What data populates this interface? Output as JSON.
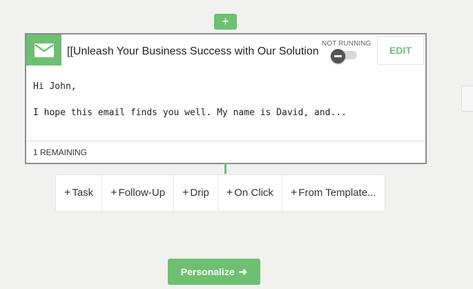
{
  "top_add": {
    "label": "+"
  },
  "card": {
    "title": "[[Unleash Your Business Success with Our Solution",
    "status": "NOT RUNNING",
    "running": false,
    "edit_label": "EDIT",
    "body_lines": [
      "Hi John,",
      "I hope this email finds you well. My name is David, and..."
    ],
    "remaining": "1 REMAINING"
  },
  "actions": [
    {
      "label": "Task"
    },
    {
      "label": "Follow-Up"
    },
    {
      "label": "Drip"
    },
    {
      "label": "On Click"
    },
    {
      "label": "From Template..."
    }
  ],
  "personalize": {
    "label": "Personalize",
    "arrow": "➜"
  },
  "colors": {
    "accent": "#6cc070",
    "card_border": "#8d8d8d",
    "background": "#f1f1f0"
  }
}
